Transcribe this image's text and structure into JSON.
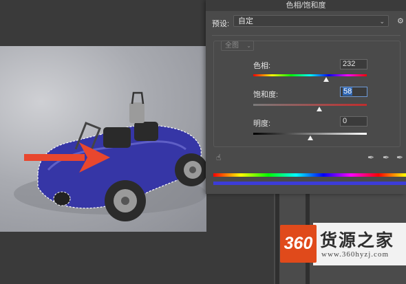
{
  "dialog": {
    "title": "色相/饱和度",
    "preset_label": "预设:",
    "preset_value": "自定",
    "channel": "全图",
    "hue_label": "色相:",
    "hue_value": "232",
    "hue_fraction": 0.64,
    "saturation_label": "饱和度:",
    "saturation_value": "58",
    "saturation_fraction": 0.58,
    "lightness_label": "明度:",
    "lightness_value": "0",
    "lightness_fraction": 0.5
  },
  "watermark": {
    "logo": "360",
    "name": "货源之家",
    "url": "www.360hyzj.com"
  },
  "colors": {
    "arrow": "#e8472e",
    "car_body": "#3a3ab0",
    "accent_blue": "#2f67b5"
  }
}
